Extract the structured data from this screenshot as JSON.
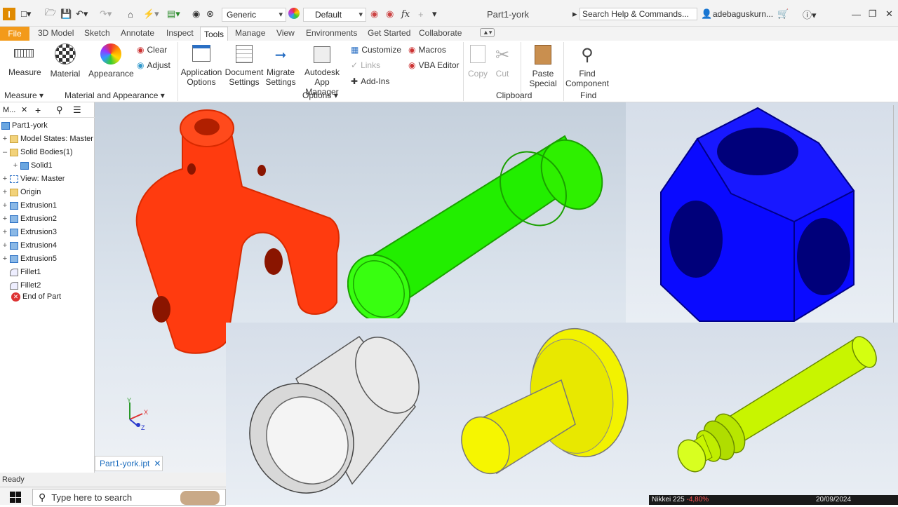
{
  "app": {
    "title": "Part1-york",
    "search_placeholder": "Search Help & Commands...",
    "user": "adebaguskurn..."
  },
  "qat": {
    "material_dropdown": "Generic",
    "appearance_dropdown": "Default",
    "fx": "fx"
  },
  "tabs": [
    "File",
    "3D Model",
    "Sketch",
    "Annotate",
    "Inspect",
    "Tools",
    "Manage",
    "View",
    "Environments",
    "Get Started",
    "Collaborate"
  ],
  "ribbon": {
    "measure": "Measure",
    "material": "Material",
    "appearance": "Appearance",
    "clear": "Clear",
    "adjust": "Adjust",
    "app_options": [
      "Application",
      "Options"
    ],
    "doc_settings": [
      "Document",
      "Settings"
    ],
    "migrate": [
      "Migrate",
      "Settings"
    ],
    "app_manager": [
      "Autodesk",
      "App Manager"
    ],
    "customize": "Customize",
    "links": "Links",
    "addins": "Add-Ins",
    "macros": "Macros",
    "vba": "VBA Editor",
    "copy": "Copy",
    "cut": "Cut",
    "paste_special": [
      "Paste",
      "Special"
    ],
    "find_component": [
      "Find",
      "Component"
    ],
    "panels": {
      "measure": "Measure",
      "material_appearance": "Material and Appearance",
      "options": "Options",
      "clipboard": "Clipboard",
      "find": "Find"
    }
  },
  "browser": {
    "tab": "M...",
    "root": "Part1-york",
    "items": [
      "Model States: Master",
      "Solid Bodies(1)",
      "Solid1",
      "View: Master",
      "Origin",
      "Extrusion1",
      "Extrusion2",
      "Extrusion3",
      "Extrusion4",
      "Extrusion5",
      "Fillet1",
      "Fillet2",
      "End of Part"
    ]
  },
  "viewcube": {
    "x": "X",
    "y": "Y",
    "z": "Z"
  },
  "doc_tab": "Part1-york.ipt",
  "status": "Ready",
  "taskbar": {
    "search_placeholder": "Type here to search"
  },
  "ticker": {
    "text": "Nikkei 225",
    "change": "-4,80%",
    "date": "20/09/2024"
  },
  "colors": {
    "accent": "#f39a1a",
    "red_part": "#ff3b0f",
    "green_part": "#22ee00",
    "blue_part": "#0a0aff",
    "yellow_part": "#f2f200",
    "lime_part": "#c8f500",
    "gray_part": "#e6e6e6"
  }
}
